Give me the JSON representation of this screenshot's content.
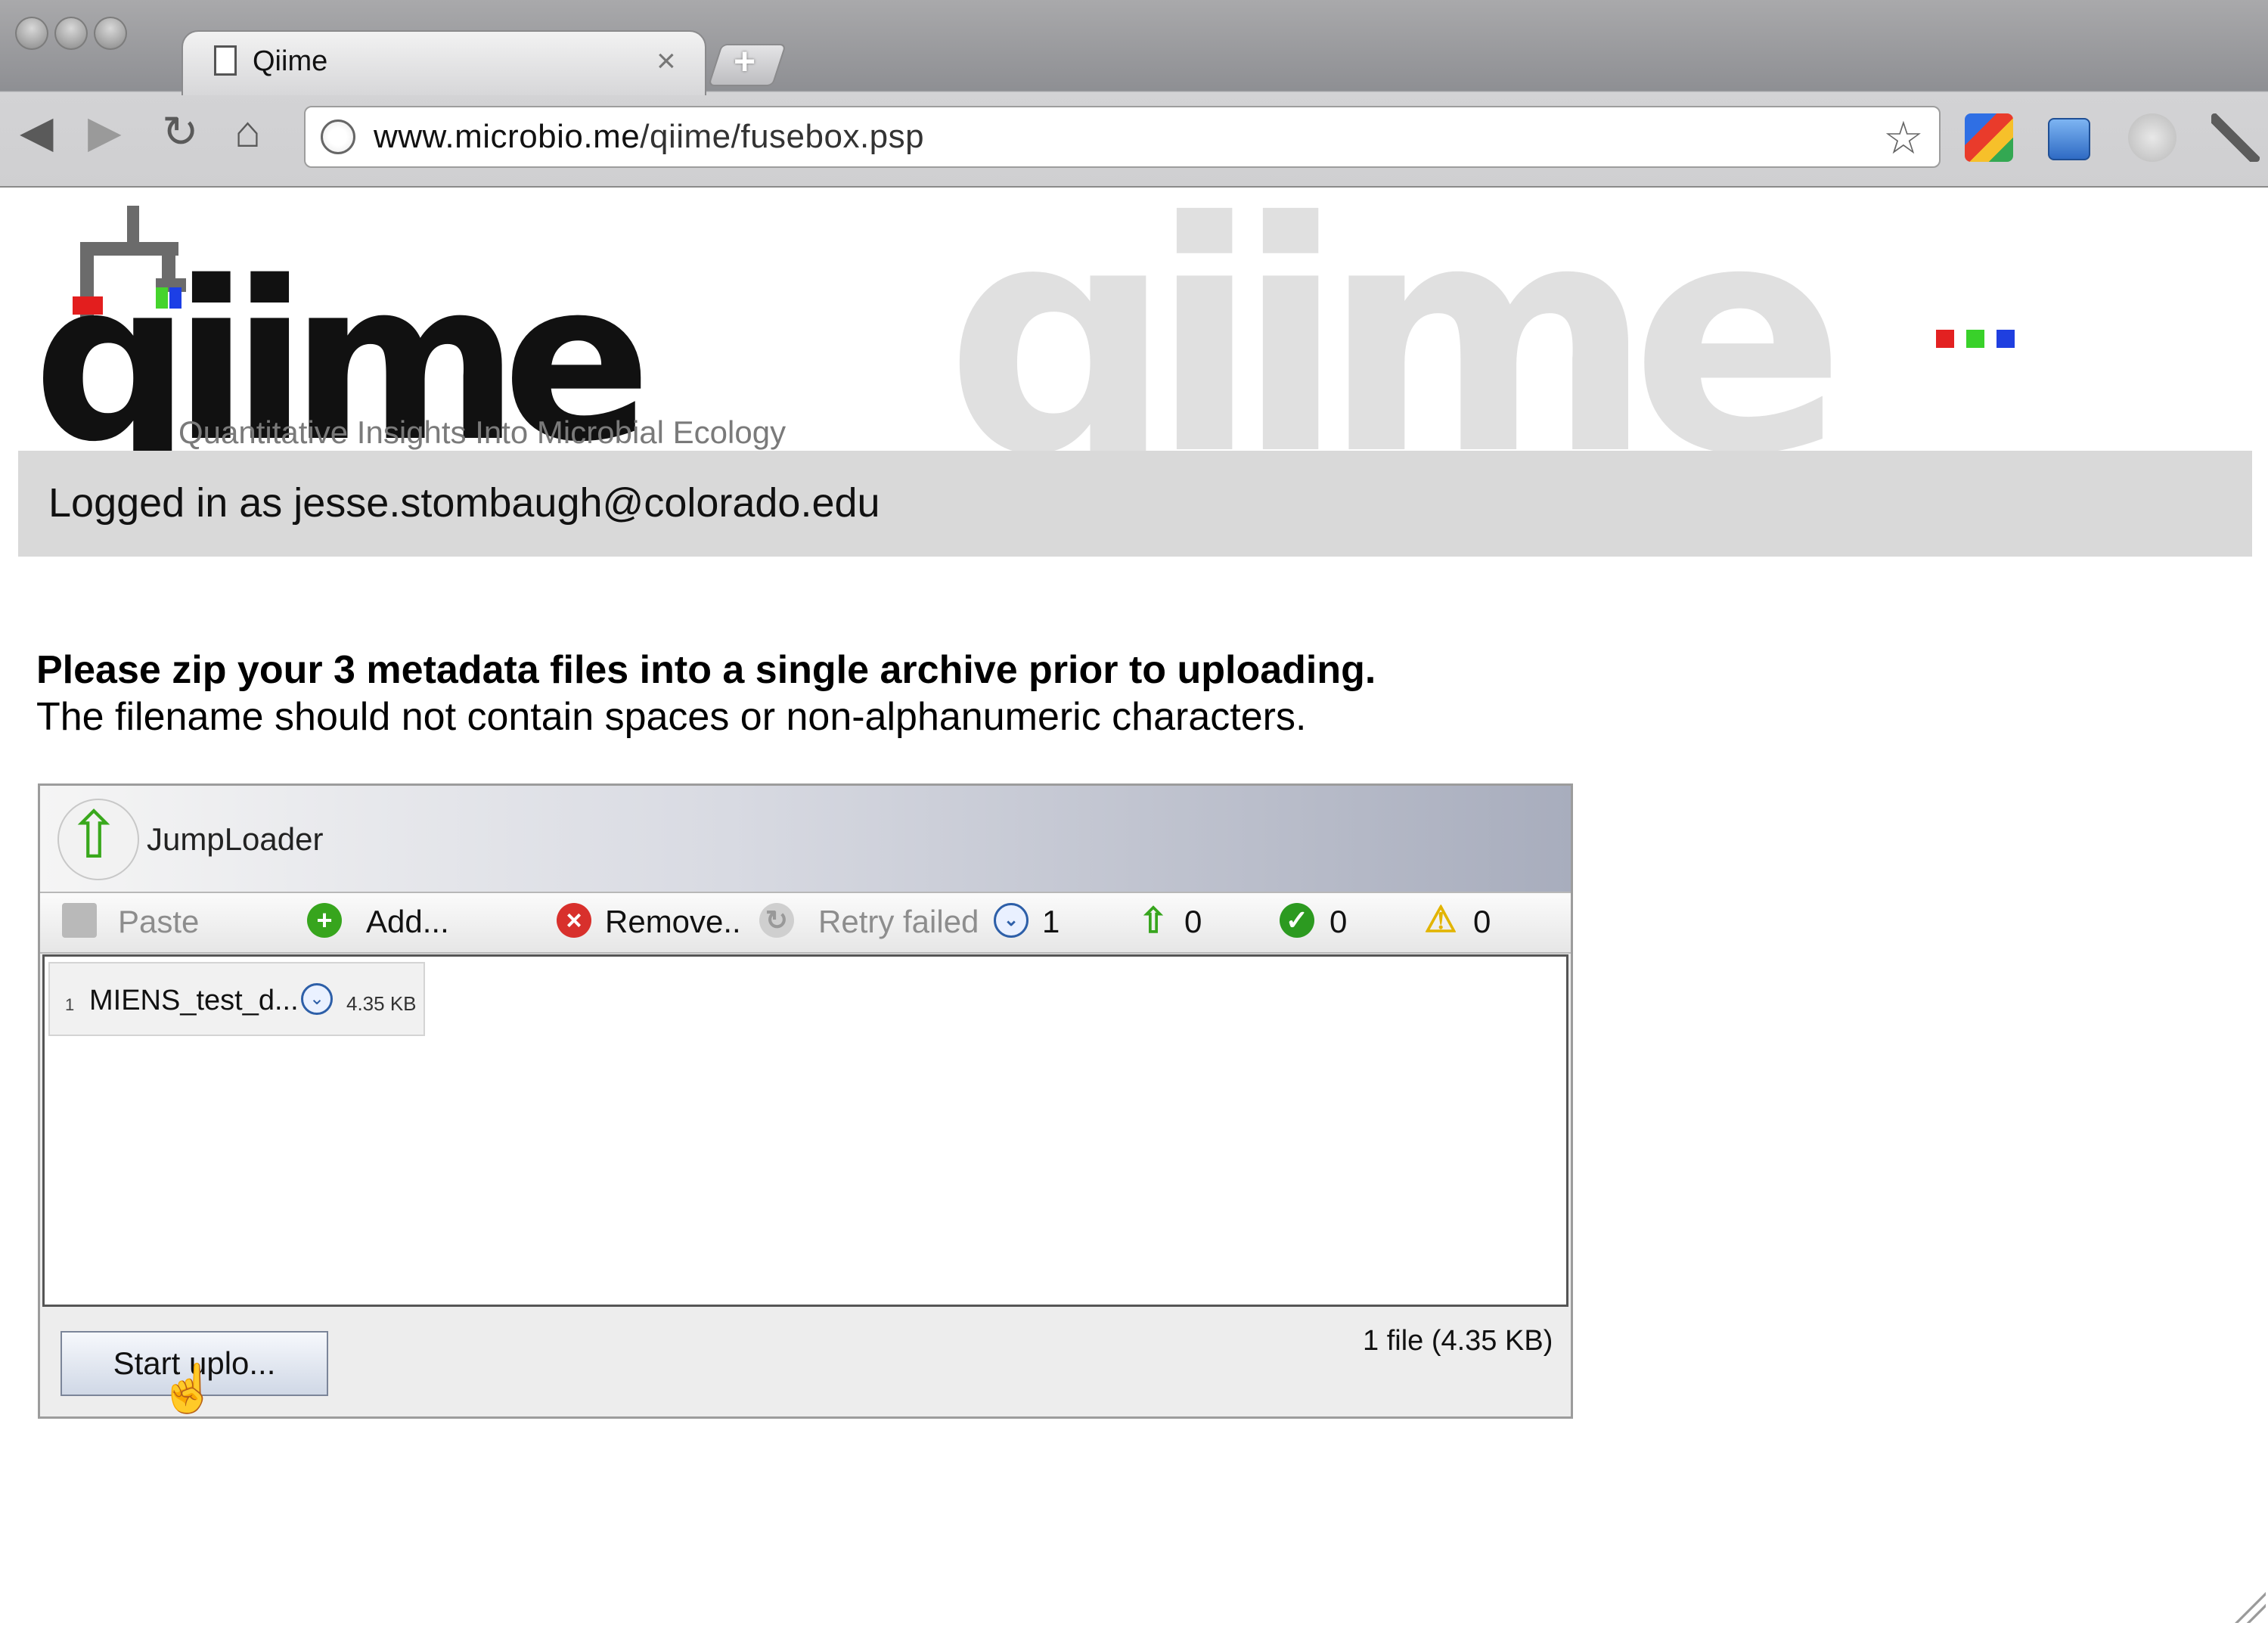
{
  "browser": {
    "tab_title": "Qiime",
    "tab_close": "×",
    "new_tab": "+",
    "url_host": "www.microbio.me",
    "url_path": "/qiime/fusebox.psp",
    "icons": {
      "back": "◀",
      "forward": "▶",
      "reload": "↻",
      "home": "⌂",
      "star": "☆"
    }
  },
  "header": {
    "logo_text": "qiime",
    "logo_subtitle": "Quantitative Insights Into Microbial Ecology",
    "watermark_text": "qiime",
    "accent_colors": [
      "#e32121",
      "#39d12a",
      "#1f3fe0"
    ]
  },
  "login": {
    "text": "Logged in as jesse.stombaugh@colorado.edu"
  },
  "instructions": {
    "bold": "Please zip your 3 metadata files into a single archive prior to uploading.",
    "normal": "The filename should not contain spaces or non-alphanumeric characters."
  },
  "applet": {
    "title": "JumpLoader",
    "toolbar": {
      "paste": "Paste",
      "add": "Add...",
      "remove": "Remove..",
      "retry": "Retry failed",
      "pending_count": "1",
      "uploading_count": "0",
      "done_count": "0",
      "failed_count": "0"
    },
    "files": [
      {
        "index": "1",
        "name": "MIENS_test_d...",
        "size": "4.35 KB"
      }
    ],
    "start_button": "Start uplo...",
    "summary": "1 file (4.35 KB)"
  }
}
